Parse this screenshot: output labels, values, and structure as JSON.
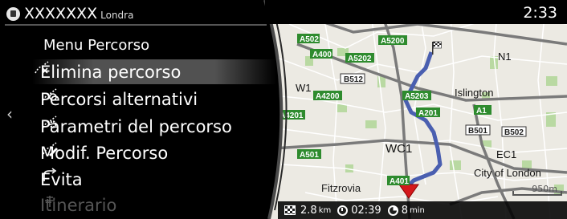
{
  "status_bar": {
    "title": "XXXXXXX",
    "city": "Londra",
    "time": "2:33"
  },
  "menu": {
    "title": "Menu Percorso",
    "items": [
      {
        "label": "Elimina percorso",
        "icon": "route-delete-icon",
        "selected": true
      },
      {
        "label": "Percorsi alternativi",
        "icon": "route-alternatives-icon",
        "selected": false
      },
      {
        "label": "Parametri del percorso",
        "icon": "route-settings-icon",
        "selected": false
      },
      {
        "label": "Modif. Percorso",
        "icon": "route-edit-icon",
        "selected": false
      },
      {
        "label": "Evita",
        "icon": "avoid-icon",
        "selected": false
      },
      {
        "label": "Itinerario",
        "icon": "itinerary-icon",
        "selected": false
      }
    ]
  },
  "map": {
    "road_labels": [
      "A502",
      "A5200",
      "A400",
      "A5202",
      "B512",
      "N1",
      "W1",
      "A4200",
      "A5203",
      "Islington",
      "A4201",
      "A201",
      "A1",
      "B501",
      "B502",
      "A501",
      "WC1",
      "EC1",
      "City of London",
      "A401",
      "Fitzrovia"
    ],
    "scale": "950m",
    "route_color": "#4a5fb0",
    "road_sign_color": "#2e8b2e"
  },
  "trip_info": {
    "distance": "2.8",
    "distance_unit": "km",
    "arrival_time": "02:39",
    "duration": "8",
    "duration_unit": "min"
  }
}
